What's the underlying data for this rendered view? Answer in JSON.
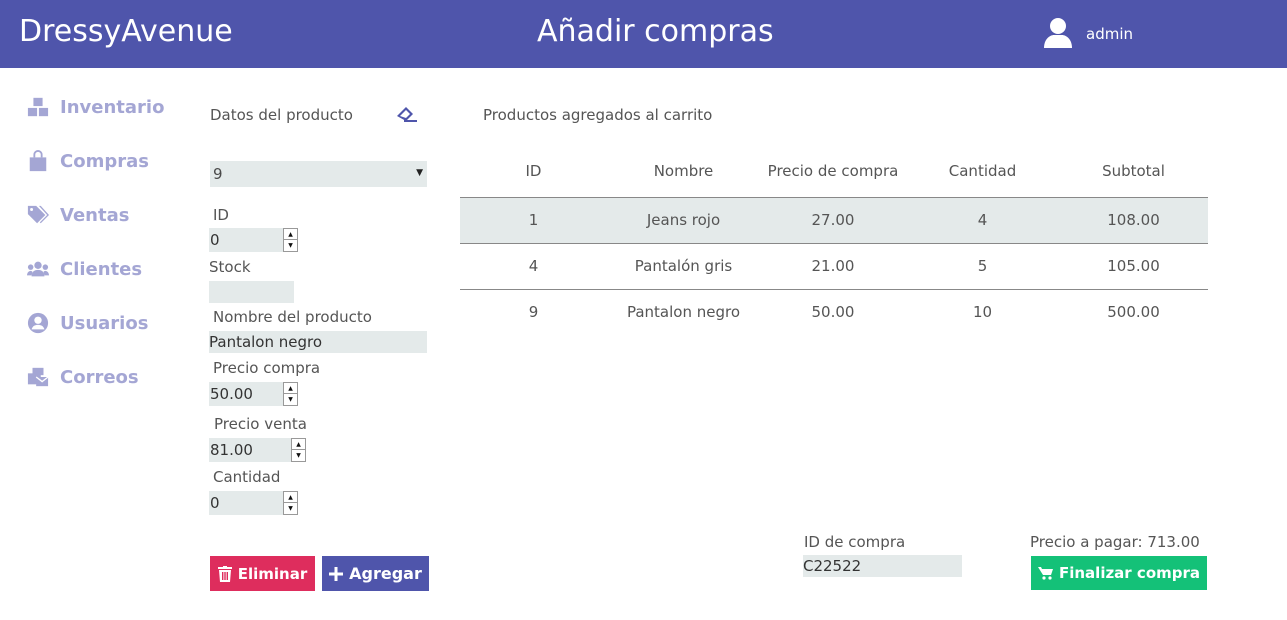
{
  "header": {
    "brand": "DressyAvenue",
    "title": "Añadir compras",
    "user": "admin",
    "user_icon": "user-icon",
    "bg_color": "#4f55ab"
  },
  "sidebar": {
    "items": [
      {
        "label": "Inventario",
        "icon": "boxes-icon"
      },
      {
        "label": "Compras",
        "icon": "shopping-bag-icon"
      },
      {
        "label": "Ventas",
        "icon": "tags-icon"
      },
      {
        "label": "Clientes",
        "icon": "users-icon"
      },
      {
        "label": "Usuarios",
        "icon": "user-circle-icon"
      },
      {
        "label": "Correos",
        "icon": "mail-bulk-icon"
      }
    ],
    "color": "#a4a6d4"
  },
  "form": {
    "section_label": "Datos del producto",
    "product_select": "9",
    "id_label": "ID",
    "id_value": "0",
    "stock_label": "Stock",
    "stock_value": "",
    "name_label": "Nombre del producto",
    "name_value": "Pantalon negro",
    "buy_price_label": "Precio compra",
    "buy_price_value": "50.00",
    "sell_price_label": "Precio venta",
    "sell_price_value": "81.00",
    "qty_label": "Cantidad",
    "qty_value": "0",
    "delete_label": "Eliminar",
    "add_label": "Agregar"
  },
  "cart": {
    "section_label": "Productos agregados al carrito",
    "columns": [
      "ID",
      "Nombre",
      "Precio de compra",
      "Cantidad",
      "Subtotal"
    ],
    "rows": [
      [
        "1",
        "Jeans rojo",
        "27.00",
        "4",
        "108.00"
      ],
      [
        "4",
        "Pantalón gris",
        "21.00",
        "5",
        "105.00"
      ],
      [
        "9",
        "Pantalon negro",
        "50.00",
        "10",
        "500.00"
      ]
    ]
  },
  "footer": {
    "purchase_id_label": "ID de compra",
    "purchase_id_value": "C22522",
    "total_label": "Precio a pagar: 713.00",
    "finish_label": "Finalizar compra"
  },
  "colors": {
    "delete": "#de2d5d",
    "add": "#4f55ab",
    "finish": "#14c178",
    "input_bg": "#e4eaea"
  }
}
